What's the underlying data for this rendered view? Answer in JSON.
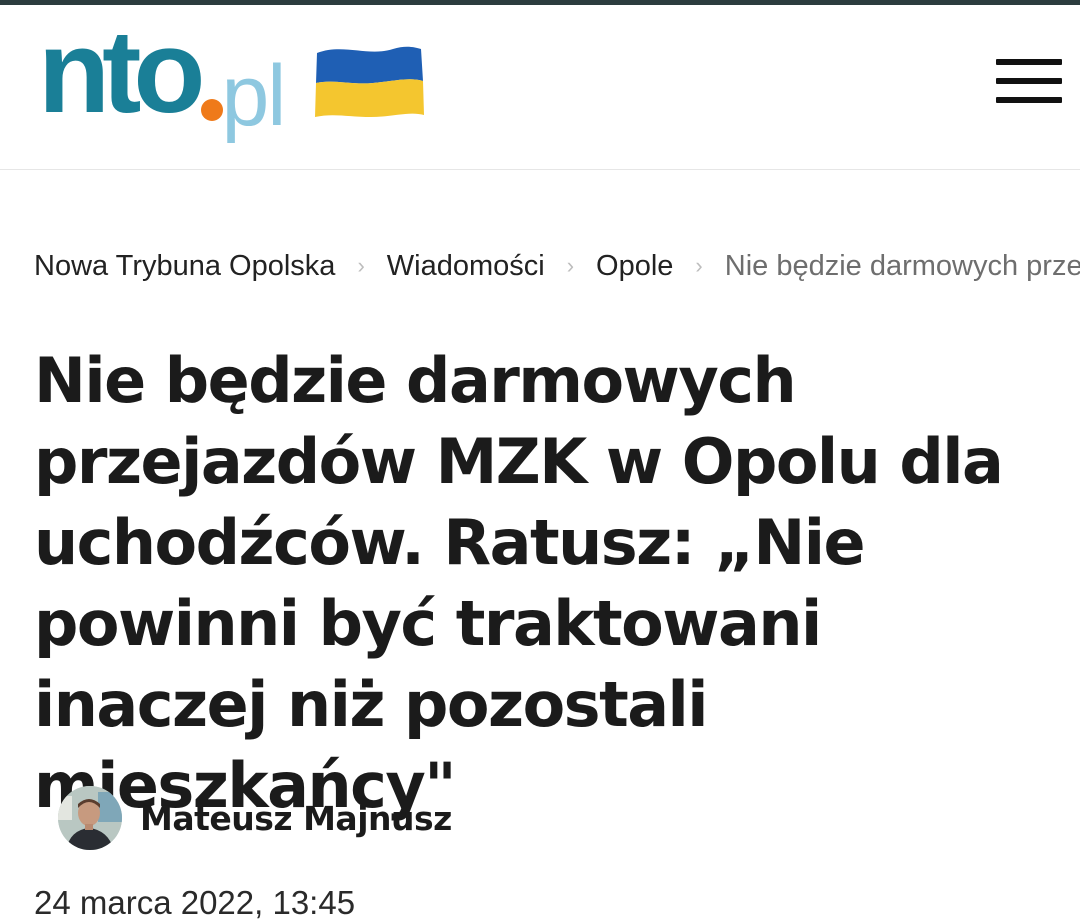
{
  "header": {
    "logo_main": "nto",
    "logo_tld": "pl",
    "flag_icon": "ukraine-flag-icon",
    "menu_icon": "hamburger-menu-icon",
    "colors": {
      "logo_main": "#1a7f97",
      "logo_dot": "#ef7a1a",
      "logo_tld": "#8ec8e0",
      "flag_blue": "#1f5fb4",
      "flag_yellow": "#f4c62f"
    }
  },
  "breadcrumb": {
    "items": [
      "Nowa Trybuna Opolska",
      "Wiadomości",
      "Opole",
      "Nie będzie darmowych przejazdów MZK w Opolu dla uchodźców"
    ],
    "separator": "›"
  },
  "article": {
    "title": "Nie będzie darmowych przejazdów MZK w Opolu dla uchodźców. Ratusz: „Nie powinni być traktowani inaczej niż pozostali mieszkańcy\"",
    "author": "Mateusz Majnusz",
    "date": "24 marca 2022, 13:45"
  }
}
